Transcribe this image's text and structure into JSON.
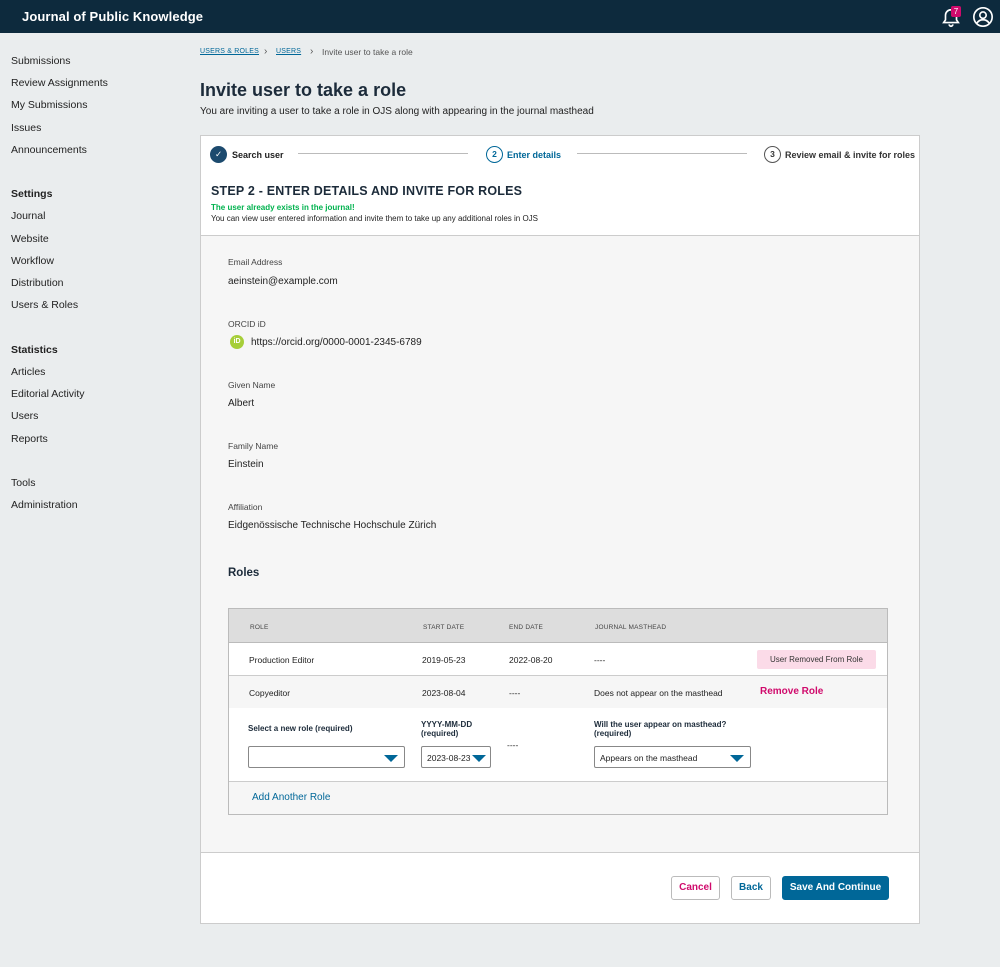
{
  "header": {
    "app_title": "Journal of Public Knowledge",
    "notification_count": "7"
  },
  "sidebar": {
    "items": [
      "Submissions",
      "Review Assignments",
      "My Submissions",
      "Issues",
      "Announcements"
    ],
    "settings_heading": "Settings",
    "settings_items": [
      "Journal",
      "Website",
      "Workflow",
      "Distribution",
      "Users & Roles"
    ],
    "statistics_heading": "Statistics",
    "statistics_items": [
      "Articles",
      "Editorial Activity",
      "Users",
      "Reports"
    ],
    "tools_items": [
      "Tools",
      "Administration"
    ]
  },
  "breadcrumb": {
    "items": [
      "USERS & ROLES",
      "USERS"
    ],
    "current": "Invite user to take a role"
  },
  "page": {
    "title": "Invite user to take a role",
    "subtitle": "You are inviting a user to take a role in OJS along with appearing in the journal masthead"
  },
  "steps": [
    {
      "number": "✓",
      "label": "Search user"
    },
    {
      "number": "2",
      "label": "Enter details"
    },
    {
      "number": "3",
      "label": "Review email & invite for roles"
    }
  ],
  "step_info": {
    "heading": "STEP 2 - ENTER DETAILS AND INVITE FOR ROLES",
    "success": "The user already exists in the journal!",
    "description": "You can view user entered information and invite them to take up any additional roles in OJS"
  },
  "user": {
    "email_label": "Email Address",
    "email": "aeinstein@example.com",
    "orcid_label": "ORCID iD",
    "orcid_icon": "iD",
    "orcid": "https://orcid.org/0000-0001-2345-6789",
    "given_label": "Given Name",
    "given": "Albert",
    "family_label": "Family Name",
    "family": "Einstein",
    "affiliation_label": "Affiliation",
    "affiliation": "Eidgenössische Technische Hochschule Zürich"
  },
  "roles": {
    "heading": "Roles",
    "columns": [
      "ROLE",
      "START DATE",
      "END DATE",
      "JOURNAL MASTHEAD"
    ],
    "rows": [
      {
        "role": "Production Editor",
        "start": "2019-05-23",
        "end": "2022-08-20",
        "masthead": "----",
        "action": "User Removed From Role"
      },
      {
        "role": "Copyeditor",
        "start": "2023-08-04",
        "end": "----",
        "masthead": "Does not appear on the masthead",
        "action": "Remove Role"
      }
    ],
    "new_role": {
      "role_label": "Select a new role (required)",
      "role_value": "",
      "date_label_1": "YYYY-MM-DD",
      "date_label_2": "(required)",
      "date_value": "2023-08-23",
      "end_value": "----",
      "masthead_label_1": "Will the user appear on masthead?",
      "masthead_label_2": "(required)",
      "masthead_value": "Appears on the masthead"
    },
    "add_label": "Add Another Role"
  },
  "footer": {
    "cancel": "Cancel",
    "back": "Back",
    "save": "Save And Continue"
  },
  "colors": {
    "header_bg": "#0d2a3d",
    "primary": "#006798",
    "danger": "#d00a6c",
    "success": "#00b24e",
    "orcid": "#a6ce39"
  }
}
